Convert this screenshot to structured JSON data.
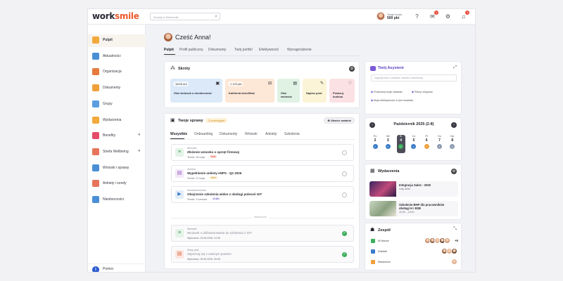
{
  "header": {
    "logo_main": "work",
    "logo_accent": "smile",
    "search_placeholder": "Szukaj w Worksmile",
    "account_label": "Twoje konto",
    "account_points": "500 pkt",
    "gift_badge": "1",
    "bell_badge": "1"
  },
  "sidebar": {
    "items": [
      {
        "label": "Pulpit",
        "color": "#f2a93b",
        "active": true
      },
      {
        "label": "Aktualności",
        "color": "#4a8fd6"
      },
      {
        "label": "Organizacja",
        "color": "#e67a3c"
      },
      {
        "label": "Dokumenty",
        "color": "#f0a03a"
      },
      {
        "label": "Grupy",
        "color": "#5a9ee0"
      },
      {
        "label": "Wydarzenia",
        "color": "#f2a93b"
      },
      {
        "label": "Benefity",
        "color": "#e64b6a",
        "caret": "▾"
      },
      {
        "label": "Strefa Wellbeing",
        "color": "#e6745a",
        "caret": "▾"
      },
      {
        "label": "Wnioski i sprawy",
        "color": "#4a8fd6"
      },
      {
        "label": "Ankiety i sondy",
        "color": "#e6745a"
      },
      {
        "label": "Nieobecności",
        "color": "#4a8fd6"
      }
    ],
    "help_label": "Pomoc"
  },
  "main": {
    "greeting": "Cześć Anna!",
    "tabs": [
      "Pulpit",
      "Profil publiczny",
      "Dokumenty",
      "Twój portfel",
      "Efektywność",
      "Wynagrodzenie"
    ]
  },
  "shortcuts": {
    "title": "Skróty",
    "tiles": [
      {
        "chip": "16/26 dni",
        "label": "Złóż wniosek o nieobecność",
        "bg": "#dbe9f8"
      },
      {
        "chip": "1 120 pkt",
        "label": "Kafeteria benefitów",
        "bg": "#fde7d6"
      },
      {
        "chip": "",
        "label": "Złóż wniosek",
        "bg": "#dff2e4"
      },
      {
        "chip": "",
        "label": "Napisz post",
        "bg": "#fbf4d6"
      },
      {
        "chip": "",
        "label": "Podaruj kudosa",
        "bg": "#fbe1e3"
      }
    ]
  },
  "tasks": {
    "title": "Twoje sprawy",
    "pending_badge": "3 oczekujące",
    "new_button": "Utwórz zadanie",
    "tabs": [
      "Wszystkie",
      "Onboarding",
      "Dokumenty",
      "Wnioski",
      "Ankiety",
      "Szkolenia"
    ],
    "items": [
      {
        "category": "Wniosek",
        "title": "Złożenie wniosku o sprzęt firmowy",
        "due": "Termin: 26 maja",
        "tag": "Dziś",
        "tag_bg": "#fde1dc",
        "tag_fg": "#d9452f",
        "icon": "≡",
        "icon_bg": "#e4f3e7",
        "icon_fg": "#3a9a55",
        "done": false
      },
      {
        "category": "Ankieta",
        "title": "Wypełnienie ankiety eNPS - Q2 2026",
        "due": "Termin: 27 maja",
        "tag": "Jutro",
        "tag_bg": "#fdf0d6",
        "tag_fg": "#c88a1e",
        "icon": "▤",
        "icon_bg": "#f3e8f8",
        "icon_fg": "#9a59c0",
        "done": false
      },
      {
        "category": "Szkolenie/tutorial",
        "title": "Obejrzenie szkolenia wideo z obsługi poleceń GIT",
        "due": "Termin: 3 czerwca",
        "tag": "6 dni",
        "tag_bg": "#eceaf8",
        "tag_fg": "#5b55b5",
        "icon": "▶",
        "icon_bg": "#e3edf8",
        "icon_fg": "#3b7bc9",
        "done": false
      },
      {
        "category": "Wniosek",
        "title": "Wniosek o dofinansowanie do szkolenia z GIT",
        "due": "Wykonano: 24.06.2026, 12:36",
        "tag": "",
        "icon": "≡",
        "icon_bg": "#e4f3e7",
        "icon_fg": "#3a9a55",
        "done": true
      },
      {
        "category": "Nowy post",
        "title": "Zapoznaj się z ważnym postem",
        "due": "Wykonano: 25.06.2026, 09:08",
        "tag": "",
        "icon": "▤",
        "icon_bg": "#fce6e0",
        "icon_fg": "#d9602f",
        "done": true
      }
    ],
    "separator_label": "Ukończone"
  },
  "assistant": {
    "title": "Twój Asystent",
    "placeholder": "Zapytaj mnie o zadania, wnioski, dokumenty...",
    "suggestions": [
      "Podsumuj moje zadania",
      "Plany urlopowe",
      "Moja efektywność w tym kwartale"
    ]
  },
  "calendar": {
    "title": "Październik 2025 (2-8)",
    "days": [
      {
        "name": "Po",
        "num": "2",
        "dot_color": "#3b7bc9",
        "dot": "▪"
      },
      {
        "name": "Wt",
        "num": "3",
        "dot_color": "#3b7bc9",
        "dot": "▪"
      },
      {
        "name": "Śr",
        "num": "4",
        "dot_color": "#3cae5b",
        "dot": "✓",
        "today": true
      },
      {
        "name": "Cz",
        "num": "5",
        "dot_color": "#3b7bc9",
        "dot": "▪"
      },
      {
        "name": "Pt",
        "num": "6",
        "dot_color": "#f0a03a",
        "dot": "▪"
      },
      {
        "name": "So",
        "num": "7",
        "dot_color": "#8e9bb0",
        "dot": "▪"
      },
      {
        "name": "Nd",
        "num": "8",
        "dot_color": "#8e9bb0",
        "dot": "▪"
      }
    ]
  },
  "events": {
    "title": "Wydarzenia",
    "items": [
      {
        "title": "Integracja Sales - 2026",
        "sub": "Cały dzień",
        "img": "linear-gradient(135deg,#3b2460,#c04a7a 55%,#2a1b46)"
      },
      {
        "title": "Szkolenie BHP dla pracowników\nobsługi H i B2B",
        "sub": "10:00 – 13:00",
        "img": "linear-gradient(135deg,#c9d6c2,#8aa07f 55%,#e8e4d6)"
      }
    ]
  },
  "team": {
    "title": "Zespół",
    "rows": [
      {
        "label": "W biurze",
        "color": "#3cae5b",
        "faces": 5,
        "extra": "+6"
      },
      {
        "label": "Zdalnie",
        "color": "#3b7bc9",
        "faces": 3,
        "extra": ""
      },
      {
        "label": "Nieobecni",
        "color": "#f0a03a",
        "faces": 1,
        "extra": ""
      }
    ]
  }
}
